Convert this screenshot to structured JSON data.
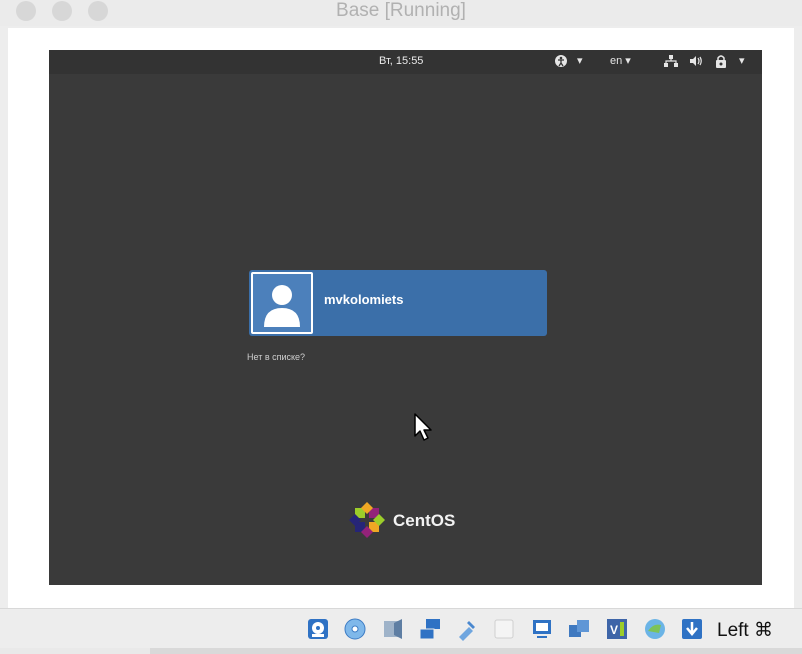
{
  "window": {
    "title": "Base [Running]"
  },
  "vm": {
    "topbar": {
      "clock": "Вт, 15:55",
      "language": "en ▾",
      "accessibility_arrow": "▾",
      "system_arrow": "▾"
    },
    "login": {
      "username": "mvkolomiets",
      "not_listed": "Нет в списке?"
    },
    "brand": {
      "name": "CentOS"
    }
  },
  "statusbar": {
    "host_key": "Left ⌘",
    "icons": [
      "hard-disk-icon",
      "optical-drive-icon",
      "audio-icon",
      "network-icon",
      "usb-icon",
      "shared-folder-icon",
      "display-icon",
      "video-capture-icon",
      "cpu-icon",
      "mouse-integration-icon",
      "host-key-arrow-icon"
    ]
  },
  "colors": {
    "vm_background": "#3a3a3a",
    "login_card": "#3b6fa9",
    "window_chrome": "#ededed"
  }
}
